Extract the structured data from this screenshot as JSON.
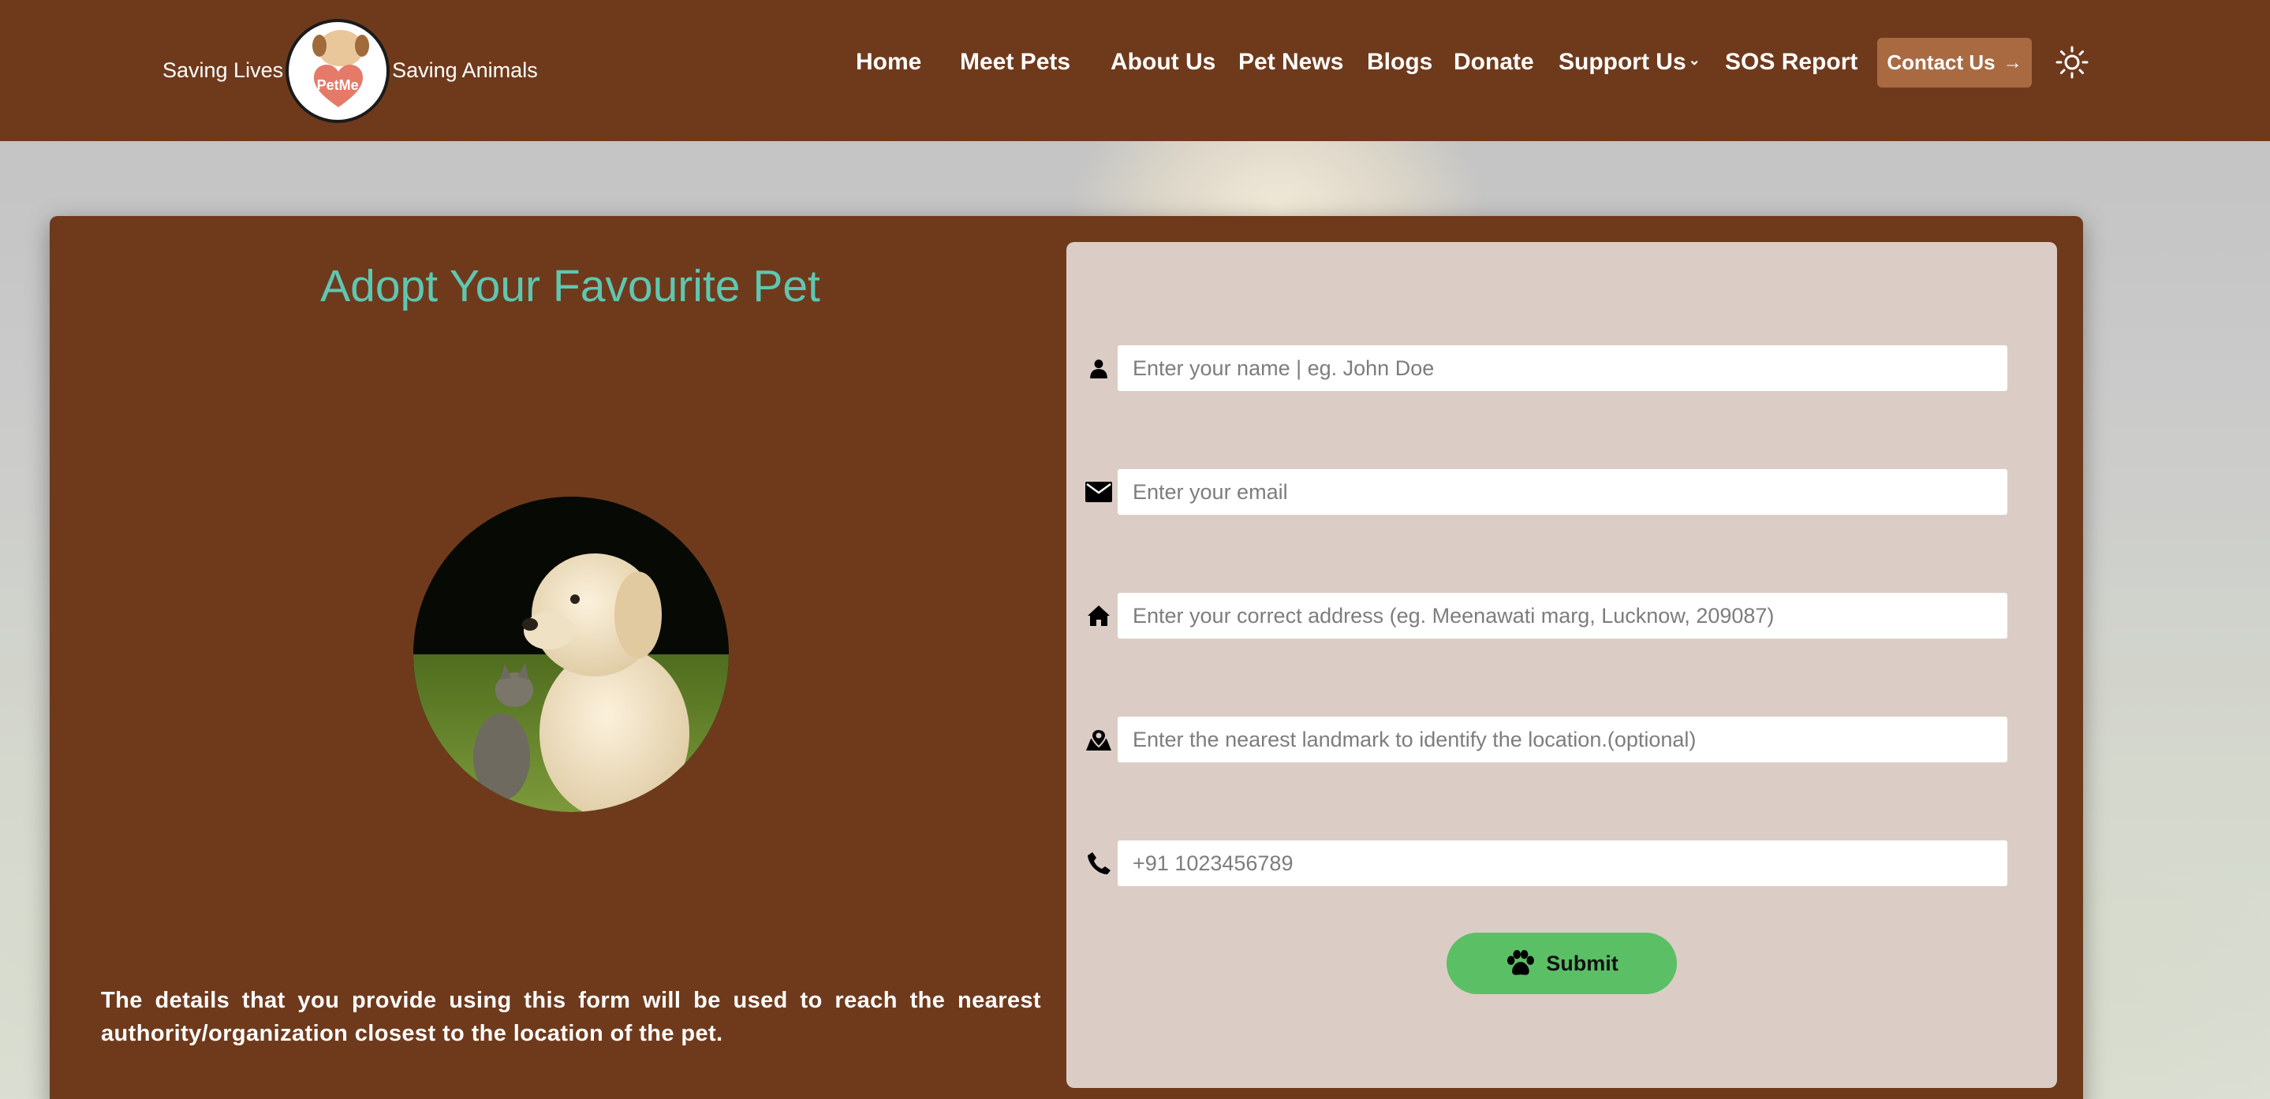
{
  "header": {
    "tagline_left": "Saving Lives",
    "tagline_right": "Saving Animals",
    "logo_text": "PetMe",
    "nav": [
      {
        "label": "Home"
      },
      {
        "label": "Meet Pets"
      },
      {
        "label": "About Us"
      },
      {
        "label": "Pet News"
      },
      {
        "label": "Blogs"
      },
      {
        "label": "Donate"
      },
      {
        "label": "Support Us"
      },
      {
        "label": "SOS Report"
      }
    ],
    "contact_label": "Contact Us",
    "theme_icon": "sun-icon"
  },
  "main": {
    "title": "Adopt Your Favourite Pet",
    "info_text": "The details that you provide using this form will be used to reach the nearest authority/organization closest to the location of the pet."
  },
  "form": {
    "name": {
      "placeholder": "Enter your name | eg. John Doe",
      "value": "",
      "icon": "person-icon"
    },
    "email": {
      "placeholder": "Enter your email",
      "value": "",
      "icon": "mail-icon"
    },
    "address": {
      "placeholder": "Enter your correct address (eg. Meenawati marg, Lucknow, 209087)",
      "value": "",
      "icon": "home-icon"
    },
    "landmark": {
      "placeholder": "Enter the nearest landmark to identify the location.(optional)",
      "value": "",
      "icon": "map-pin-icon"
    },
    "phone": {
      "placeholder": "+91 1023456789",
      "value": "",
      "icon": "phone-icon"
    },
    "submit_label": "Submit",
    "submit_icon": "paw-icon"
  },
  "colors": {
    "header_bg": "#6f3a1c",
    "card_bg": "#6f3a1c",
    "form_bg": "#dbcdc5",
    "title": "#5ec7b2",
    "contact_button": "#a96a42",
    "submit_button": "#5bbf66"
  }
}
